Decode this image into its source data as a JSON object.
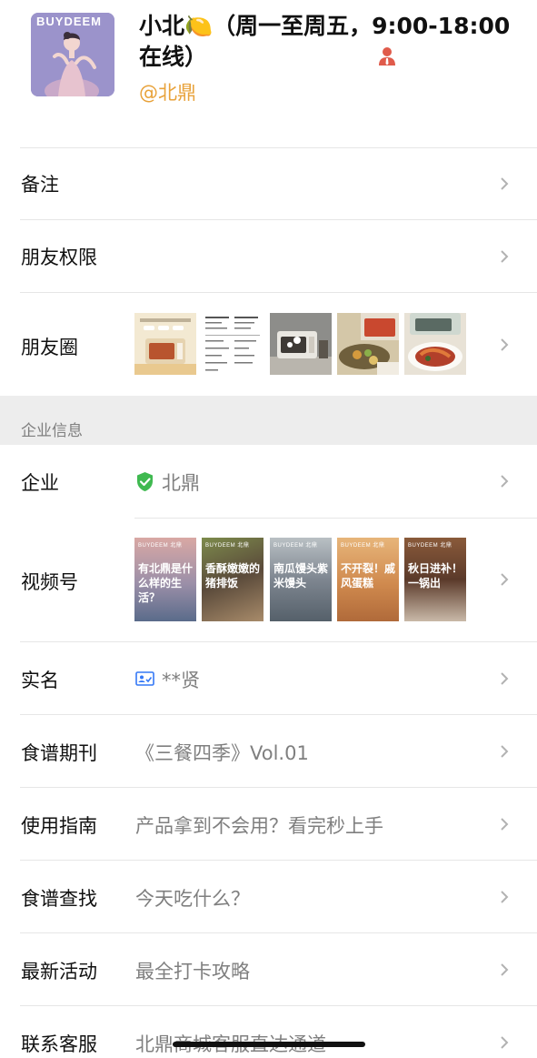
{
  "profile": {
    "name": "小北🍋（周一至周五，9:00-18:00在线）",
    "handle": "@北鼎",
    "avatar_brand": "BUYDEEM",
    "avatar_icon": "avatar-illustration",
    "badge_icon": "person-icon"
  },
  "rows": {
    "remark": {
      "label": "备注"
    },
    "friend_permission": {
      "label": "朋友权限"
    },
    "moments": {
      "label": "朋友圈"
    },
    "company": {
      "label": "企业",
      "value": "北鼎",
      "icon": "verified-shield-icon"
    },
    "channels": {
      "label": "视频号"
    },
    "realname": {
      "label": "实名",
      "value": "**贤",
      "icon": "id-card-icon"
    },
    "recipe_journal": {
      "label": "食谱期刊",
      "value": "《三餐四季》Vol.01"
    },
    "guide": {
      "label": "使用指南",
      "value": "产品拿到不会用？看完秒上手"
    },
    "recipe_search": {
      "label": "食谱查找",
      "value": "今天吃什么？"
    },
    "activity": {
      "label": "最新活动",
      "value": "最全打卡攻略"
    },
    "service": {
      "label": "联系客服",
      "value": "北鼎商城客服直达通道"
    }
  },
  "section": {
    "title": "企业信息"
  },
  "moments_thumbs": [
    "oven-product-photo",
    "document-page-photo",
    "oven-kitchen-photo",
    "food-tray-photo",
    "roast-dish-photo"
  ],
  "video_thumbs": [
    {
      "brand": "BUYDEEM 北鼎",
      "text": "有北鼎是什么样的生活？"
    },
    {
      "brand": "BUYDEEM 北鼎",
      "text": "香酥嫩嫩的猪排饭"
    },
    {
      "brand": "BUYDEEM 北鼎",
      "text": "南瓜馒头紫米馒头"
    },
    {
      "brand": "BUYDEEM 北鼎",
      "text": "不开裂！戚风蛋糕"
    },
    {
      "brand": "BUYDEEM 北鼎",
      "text": "秋日进补！一锅出"
    }
  ],
  "colors": {
    "accent": "#e8a23a",
    "verified": "#3fb950",
    "id_card": "#3478f6",
    "badge": "#e05b4b",
    "separator_band": "#ededed"
  }
}
